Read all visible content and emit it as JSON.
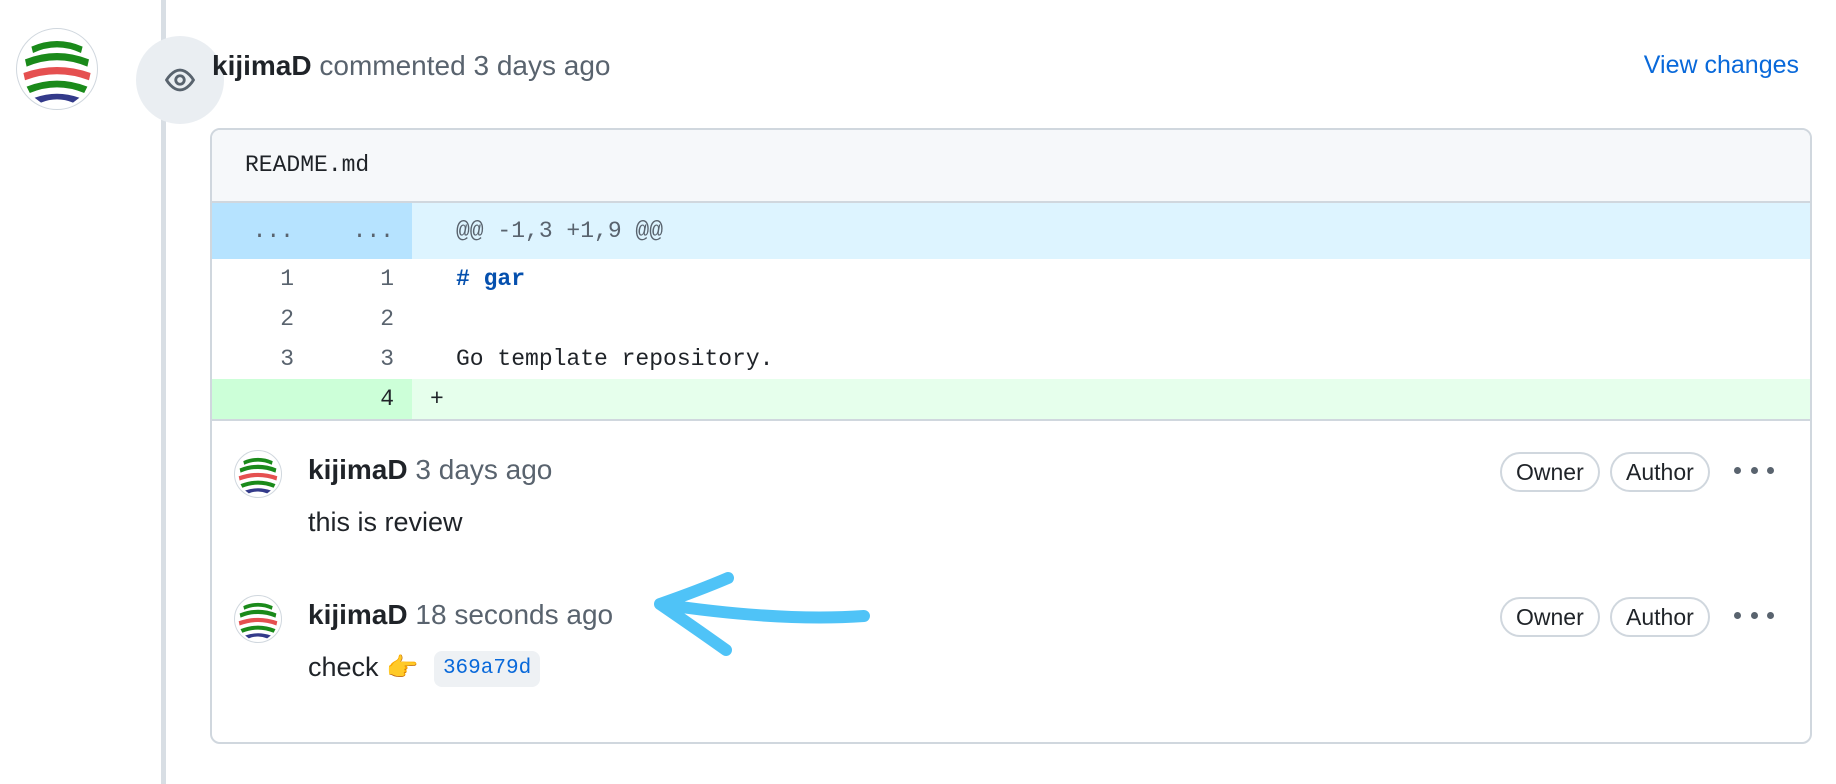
{
  "review": {
    "user": "kijimaD",
    "action_text": "commented",
    "time": "3 days ago",
    "view_changes_label": "View changes",
    "avatar_icon": "identicon-avatar",
    "event_icon": "eye-icon"
  },
  "file": {
    "name": "README.md"
  },
  "diff": {
    "hunk": {
      "old": "...",
      "new": "...",
      "header": "@@ -1,3 +1,9 @@"
    },
    "lines": [
      {
        "old": "1",
        "new": "1",
        "marker": "# ",
        "text": "gar"
      },
      {
        "old": "2",
        "new": "2",
        "text": ""
      },
      {
        "old": "3",
        "new": "3",
        "text": "Go template repository."
      }
    ],
    "added": {
      "old": "",
      "new": "4",
      "text": "+"
    }
  },
  "comments": [
    {
      "user": "kijimaD",
      "time": "3 days ago",
      "body": "this is review",
      "labels": [
        "Owner",
        "Author"
      ]
    },
    {
      "user": "kijimaD",
      "time": "18 seconds ago",
      "body": "check",
      "emoji": "👉",
      "commit_sha": "369a79d",
      "labels": [
        "Owner",
        "Author"
      ]
    }
  ],
  "colors": {
    "link": "#0969da",
    "annotation_arrow": "#4fc3f7",
    "hunk_bg": "#ddf4ff",
    "added_bg": "#e6ffec"
  }
}
